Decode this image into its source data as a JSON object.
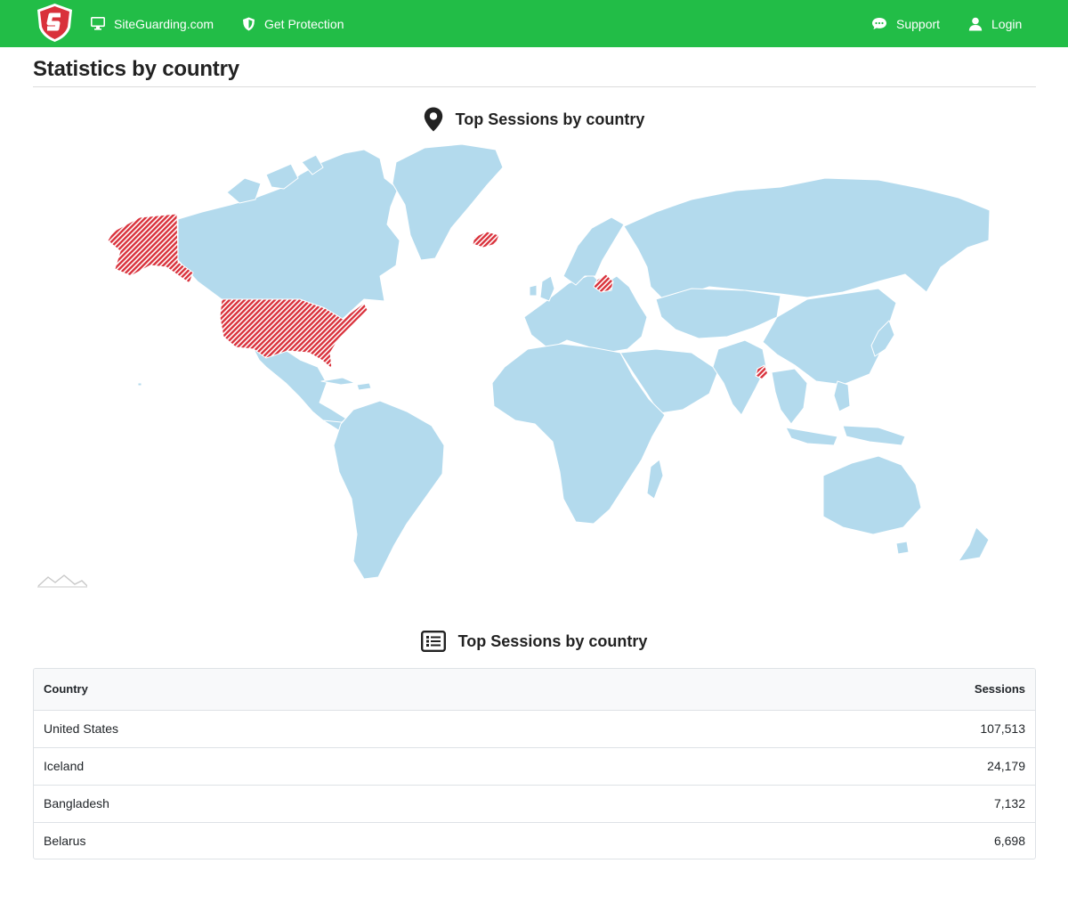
{
  "nav": {
    "site_label": "SiteGuarding.com",
    "protect_label": "Get Protection",
    "support_label": "Support",
    "login_label": "Login"
  },
  "colors": {
    "brand_green": "#22bd47",
    "map_land": "#b3daed",
    "map_highlight": "#d9313b"
  },
  "page": {
    "title": "Statistics by country"
  },
  "map_section": {
    "heading": "Top Sessions by country",
    "icon": "map-pin-icon",
    "highlighted_countries": [
      "United States",
      "Iceland",
      "Bangladesh",
      "Belarus"
    ]
  },
  "table_section": {
    "heading": "Top Sessions by country",
    "icon": "list-icon",
    "columns": {
      "country": "Country",
      "sessions": "Sessions"
    },
    "rows": [
      {
        "country": "United States",
        "sessions": "107,513"
      },
      {
        "country": "Iceland",
        "sessions": "24,179"
      },
      {
        "country": "Bangladesh",
        "sessions": "7,132"
      },
      {
        "country": "Belarus",
        "sessions": "6,698"
      }
    ]
  }
}
